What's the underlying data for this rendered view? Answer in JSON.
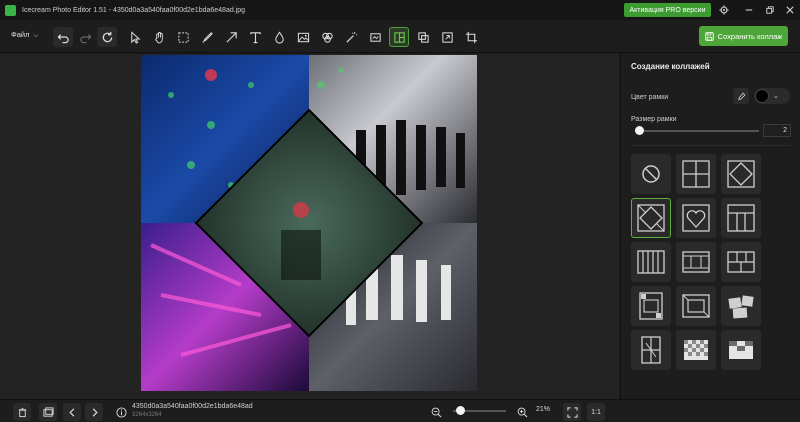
{
  "titlebar": {
    "title": "Icecream Photo Editor 1.51 - 4350d0a3a540faa0f00d2e1bda6e48ad.jpg",
    "pro_label": "Активация PRO версии"
  },
  "toolbar": {
    "file_menu": "Файл",
    "save_label": "Сохранить коллаж"
  },
  "panel": {
    "title": "Создание коллажей",
    "frame_color_label": "Цвет рамки",
    "frame_color": "#000000",
    "frame_size_label": "Размер рамки",
    "frame_size_value": "2",
    "frame_size_fraction": 0.0
  },
  "status": {
    "file_name": "4350d0a3a540faa0f00d2e1bda6e48ad",
    "dimensions": "3264x3264",
    "zoom": "21%",
    "zoom_fraction": 0.05,
    "actual_size": "1:1"
  },
  "colors": {
    "accent": "#4ea53a",
    "background": "#1b1b1b",
    "panel": "#1d1d1d"
  }
}
